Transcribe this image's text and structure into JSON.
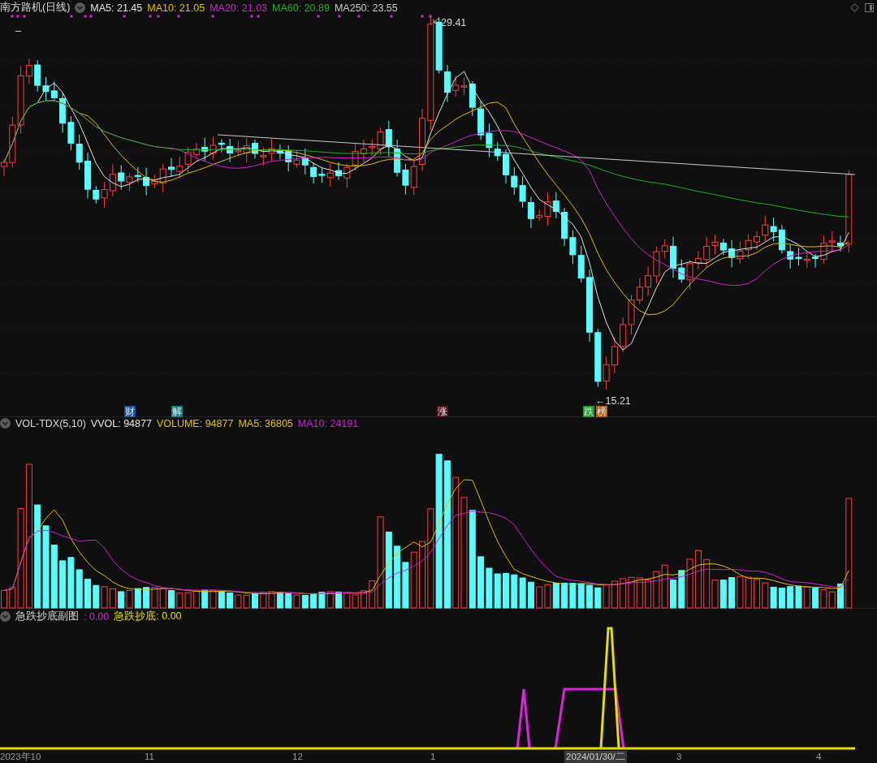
{
  "price_panel": {
    "title": "南方路机(日线)",
    "indicators": [
      {
        "label": "MA5: 21.45",
        "color": "#e6e6e6"
      },
      {
        "label": "MA10: 21.05",
        "color": "#e0c000"
      },
      {
        "label": "MA20: 21.03",
        "color": "#d020d0"
      },
      {
        "label": "MA60: 20.89",
        "color": "#20b020"
      },
      {
        "label": "MA250: 23.55",
        "color": "#c8c8c8"
      }
    ],
    "high_label": "29.41",
    "low_label": "←15.21",
    "markers": [
      {
        "text": "财",
        "color": "#1f4f9a"
      },
      {
        "text": "解",
        "color": "#0f7f78"
      },
      {
        "text": "涨",
        "color": "#5a1010"
      },
      {
        "text": "跌",
        "color": "#1f9a2a"
      },
      {
        "text": "榜",
        "color": "#b0601a"
      }
    ]
  },
  "volume_panel": {
    "title": "VOL-TDX(5,10)",
    "indicators": [
      {
        "label": "VVOL: 94877",
        "color": "#e6e6e6"
      },
      {
        "label": "VOLUME: 94877",
        "color": "#e0c000"
      },
      {
        "label": "MA5: 36805",
        "color": "#e0c000"
      },
      {
        "label": "MA10: 24191",
        "color": "#d020d0"
      }
    ]
  },
  "sub_panel": {
    "title": "急跌抄底副图",
    "indicators": [
      {
        "label": ": 0.00",
        "color": "#e020e0"
      },
      {
        "label": "急跌抄底: 0.00",
        "color": "#e0e000"
      }
    ]
  },
  "x_axis": [
    {
      "label": "2023年10",
      "selected": false
    },
    {
      "label": "11",
      "selected": false
    },
    {
      "label": "12",
      "selected": false
    },
    {
      "label": "1",
      "selected": false
    },
    {
      "label": "2024/01/30/二",
      "selected": true
    },
    {
      "label": "3",
      "selected": false
    },
    {
      "label": "4",
      "selected": false
    }
  ]
}
